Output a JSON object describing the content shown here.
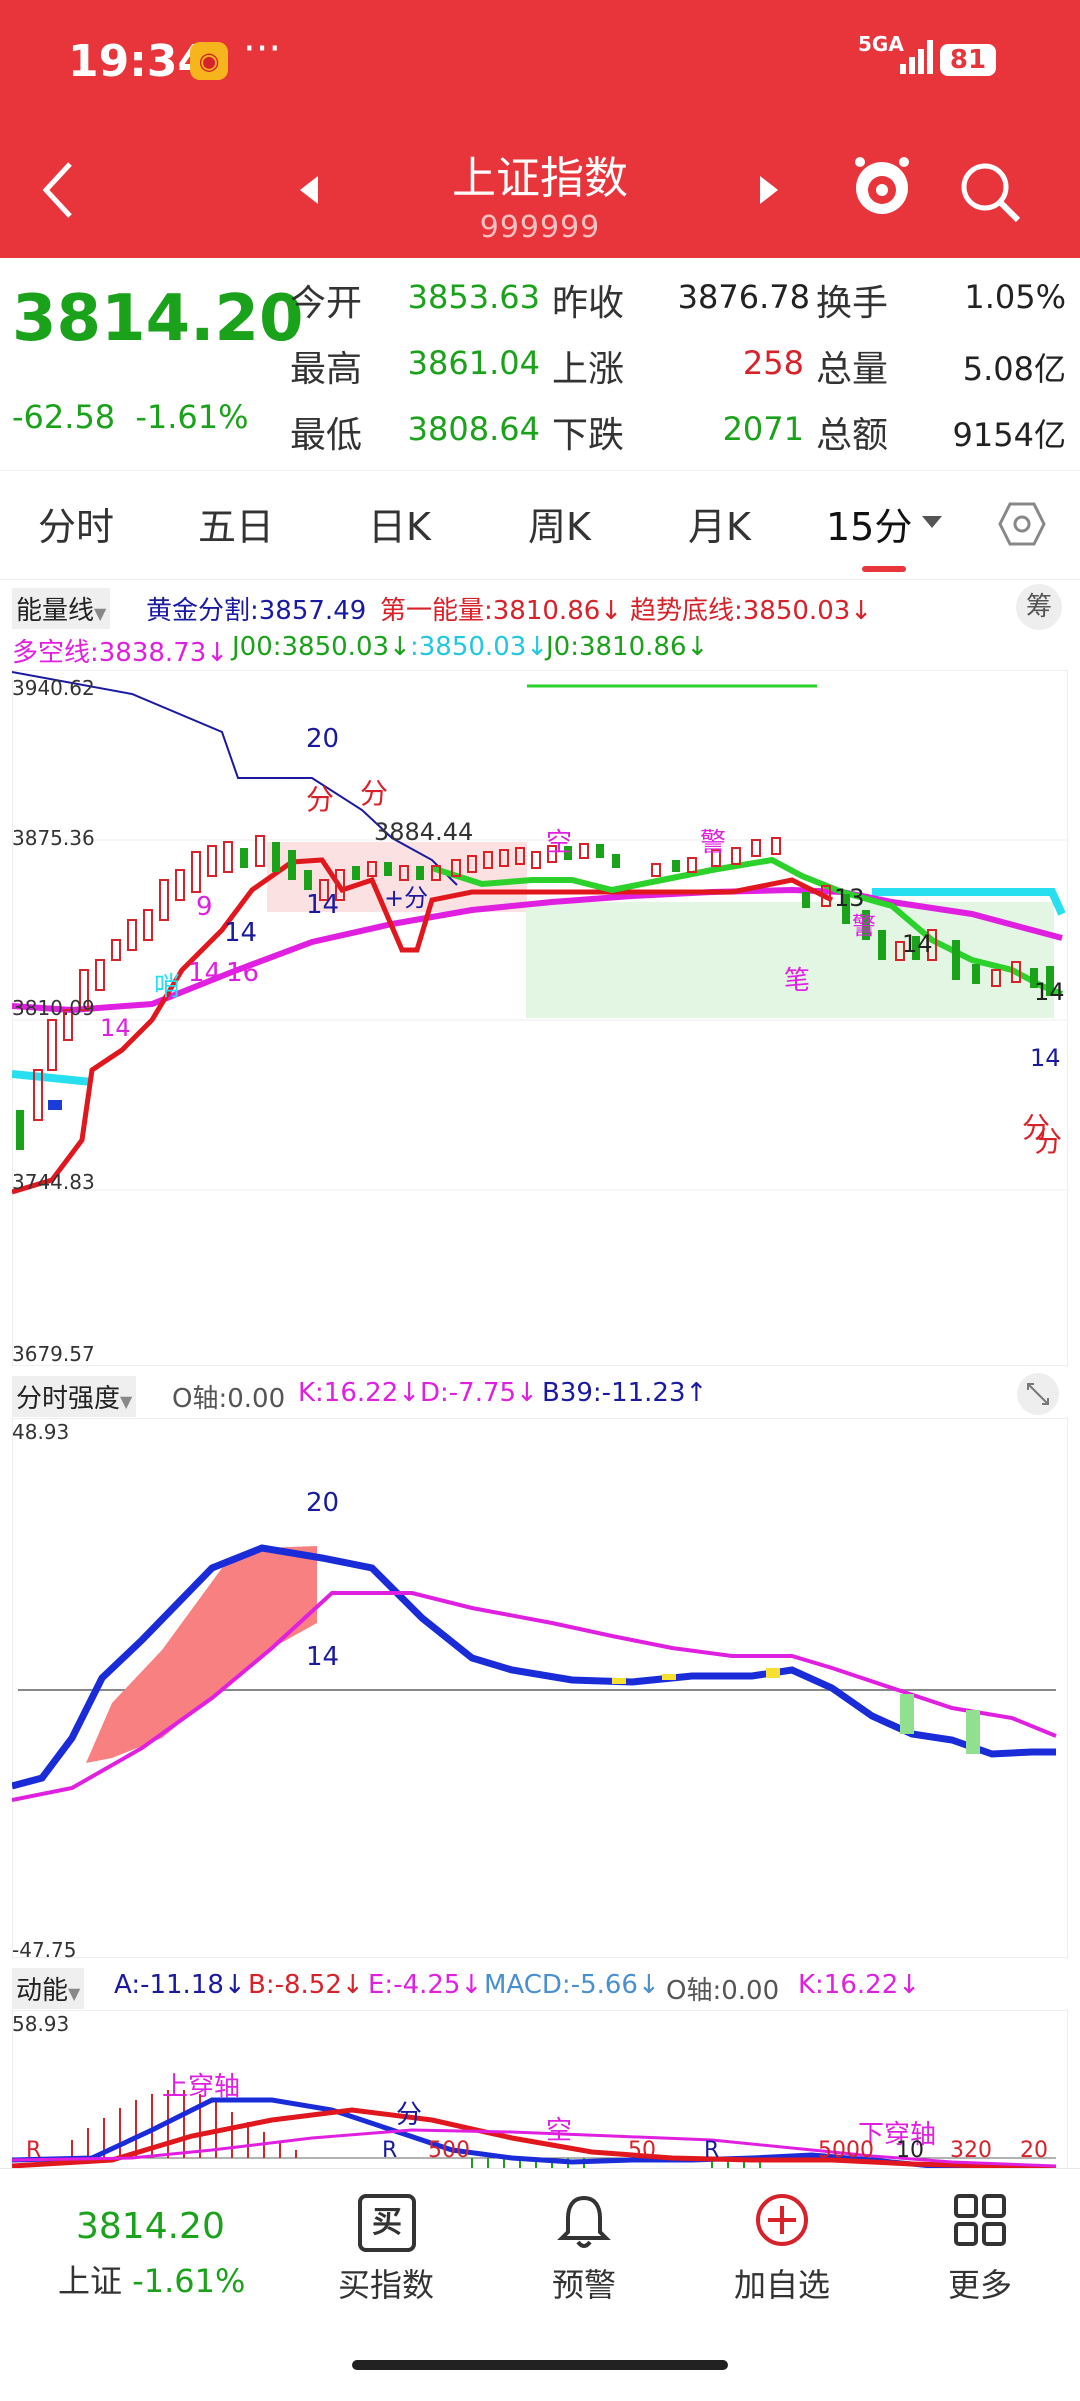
{
  "status": {
    "time": "19:34",
    "network": "5GA",
    "battery": "81",
    "dots": "···"
  },
  "header": {
    "title": "上证指数",
    "code": "999999"
  },
  "quote": {
    "price": "3814.20",
    "change": "-62.58",
    "change_pct": "-1.61%",
    "rows": [
      {
        "l1": "今开",
        "v1": "3853.63",
        "l2": "昨收",
        "v2": "3876.78",
        "l3": "换手",
        "v3": "1.05%"
      },
      {
        "l1": "最高",
        "v1": "3861.04",
        "l2": "上涨",
        "v2": "258",
        "l3": "总量",
        "v3": "5.08亿"
      },
      {
        "l1": "最低",
        "v1": "3808.64",
        "l2": "下跌",
        "v2": "2071",
        "l3": "总额",
        "v3": "9154亿"
      }
    ]
  },
  "tabs": [
    "分时",
    "五日",
    "日K",
    "周K",
    "月K",
    "15分"
  ],
  "main_chart": {
    "indicator_name": "能量线",
    "row1": [
      "黄金分割:3857.49",
      "第一能量:3810.86↓",
      "趋势底线:3850.03↓"
    ],
    "row2": [
      "多空线:3838.73↓",
      "J00:3850.03↓",
      ":3850.03↓",
      "J0:3810.86↓"
    ],
    "side_button": "筹",
    "axis": [
      "3940.62",
      "3875.36",
      "3810.09",
      "3744.83",
      "3679.57"
    ],
    "annotations": [
      "20",
      "分",
      "分",
      "3884.44",
      "空",
      "警",
      "14",
      "+分",
      "9",
      "14",
      "14",
      "16",
      "哨",
      "14",
      "13",
      "警",
      "14",
      "笔",
      "14",
      "14",
      "分",
      "分"
    ]
  },
  "strength_chart": {
    "name": "分时强度",
    "values": [
      "O轴:0.00",
      "K:16.22↓",
      "D:-7.75↓",
      "B39:-11.23↑"
    ],
    "axis_top": "48.93",
    "axis_bottom": "-47.75",
    "annotations": [
      "20",
      "14"
    ]
  },
  "momentum_chart": {
    "name": "动能",
    "values": [
      "A:-11.18↓",
      "B:-8.52↓",
      "E:-4.25↓",
      "MACD:-5.66↓",
      "O轴:0.00",
      "K:16.22↓"
    ],
    "axis_top": "58.93",
    "annotations": [
      "上穿轴",
      "分",
      "空",
      "下穿轴",
      "R",
      "R",
      "500",
      "50",
      "R",
      "5000",
      "10",
      "320",
      "20"
    ]
  },
  "bottom": {
    "price": "3814.20",
    "name": "上证",
    "pct": "-1.61%",
    "buttons": [
      {
        "icon": "buy-icon",
        "label": "买指数",
        "glyph": "买"
      },
      {
        "icon": "bell-icon",
        "label": "预警"
      },
      {
        "icon": "add-icon",
        "label": "加自选"
      },
      {
        "icon": "grid-icon",
        "label": "更多"
      }
    ]
  },
  "colors": {
    "header_red": "#e7353b",
    "up_red": "#d8222a",
    "down_green": "#1aa21a",
    "magenta": "#e020e0",
    "navy": "#1a1aa0"
  }
}
